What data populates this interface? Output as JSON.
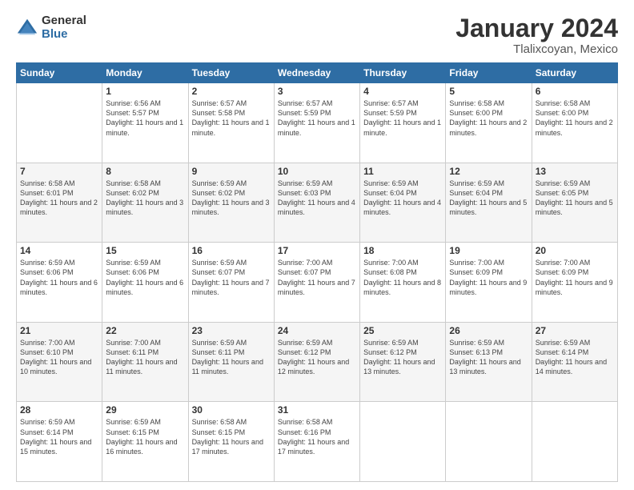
{
  "header": {
    "logo_general": "General",
    "logo_blue": "Blue",
    "title": "January 2024",
    "location": "Tlalixcoyan, Mexico"
  },
  "days_of_week": [
    "Sunday",
    "Monday",
    "Tuesday",
    "Wednesday",
    "Thursday",
    "Friday",
    "Saturday"
  ],
  "weeks": [
    [
      {
        "day": "",
        "sunrise": "",
        "sunset": "",
        "daylight": ""
      },
      {
        "day": "1",
        "sunrise": "Sunrise: 6:56 AM",
        "sunset": "Sunset: 5:57 PM",
        "daylight": "Daylight: 11 hours and 1 minute."
      },
      {
        "day": "2",
        "sunrise": "Sunrise: 6:57 AM",
        "sunset": "Sunset: 5:58 PM",
        "daylight": "Daylight: 11 hours and 1 minute."
      },
      {
        "day": "3",
        "sunrise": "Sunrise: 6:57 AM",
        "sunset": "Sunset: 5:59 PM",
        "daylight": "Daylight: 11 hours and 1 minute."
      },
      {
        "day": "4",
        "sunrise": "Sunrise: 6:57 AM",
        "sunset": "Sunset: 5:59 PM",
        "daylight": "Daylight: 11 hours and 1 minute."
      },
      {
        "day": "5",
        "sunrise": "Sunrise: 6:58 AM",
        "sunset": "Sunset: 6:00 PM",
        "daylight": "Daylight: 11 hours and 2 minutes."
      },
      {
        "day": "6",
        "sunrise": "Sunrise: 6:58 AM",
        "sunset": "Sunset: 6:00 PM",
        "daylight": "Daylight: 11 hours and 2 minutes."
      }
    ],
    [
      {
        "day": "7",
        "sunrise": "Sunrise: 6:58 AM",
        "sunset": "Sunset: 6:01 PM",
        "daylight": "Daylight: 11 hours and 2 minutes."
      },
      {
        "day": "8",
        "sunrise": "Sunrise: 6:58 AM",
        "sunset": "Sunset: 6:02 PM",
        "daylight": "Daylight: 11 hours and 3 minutes."
      },
      {
        "day": "9",
        "sunrise": "Sunrise: 6:59 AM",
        "sunset": "Sunset: 6:02 PM",
        "daylight": "Daylight: 11 hours and 3 minutes."
      },
      {
        "day": "10",
        "sunrise": "Sunrise: 6:59 AM",
        "sunset": "Sunset: 6:03 PM",
        "daylight": "Daylight: 11 hours and 4 minutes."
      },
      {
        "day": "11",
        "sunrise": "Sunrise: 6:59 AM",
        "sunset": "Sunset: 6:04 PM",
        "daylight": "Daylight: 11 hours and 4 minutes."
      },
      {
        "day": "12",
        "sunrise": "Sunrise: 6:59 AM",
        "sunset": "Sunset: 6:04 PM",
        "daylight": "Daylight: 11 hours and 5 minutes."
      },
      {
        "day": "13",
        "sunrise": "Sunrise: 6:59 AM",
        "sunset": "Sunset: 6:05 PM",
        "daylight": "Daylight: 11 hours and 5 minutes."
      }
    ],
    [
      {
        "day": "14",
        "sunrise": "Sunrise: 6:59 AM",
        "sunset": "Sunset: 6:06 PM",
        "daylight": "Daylight: 11 hours and 6 minutes."
      },
      {
        "day": "15",
        "sunrise": "Sunrise: 6:59 AM",
        "sunset": "Sunset: 6:06 PM",
        "daylight": "Daylight: 11 hours and 6 minutes."
      },
      {
        "day": "16",
        "sunrise": "Sunrise: 6:59 AM",
        "sunset": "Sunset: 6:07 PM",
        "daylight": "Daylight: 11 hours and 7 minutes."
      },
      {
        "day": "17",
        "sunrise": "Sunrise: 7:00 AM",
        "sunset": "Sunset: 6:07 PM",
        "daylight": "Daylight: 11 hours and 7 minutes."
      },
      {
        "day": "18",
        "sunrise": "Sunrise: 7:00 AM",
        "sunset": "Sunset: 6:08 PM",
        "daylight": "Daylight: 11 hours and 8 minutes."
      },
      {
        "day": "19",
        "sunrise": "Sunrise: 7:00 AM",
        "sunset": "Sunset: 6:09 PM",
        "daylight": "Daylight: 11 hours and 9 minutes."
      },
      {
        "day": "20",
        "sunrise": "Sunrise: 7:00 AM",
        "sunset": "Sunset: 6:09 PM",
        "daylight": "Daylight: 11 hours and 9 minutes."
      }
    ],
    [
      {
        "day": "21",
        "sunrise": "Sunrise: 7:00 AM",
        "sunset": "Sunset: 6:10 PM",
        "daylight": "Daylight: 11 hours and 10 minutes."
      },
      {
        "day": "22",
        "sunrise": "Sunrise: 7:00 AM",
        "sunset": "Sunset: 6:11 PM",
        "daylight": "Daylight: 11 hours and 11 minutes."
      },
      {
        "day": "23",
        "sunrise": "Sunrise: 6:59 AM",
        "sunset": "Sunset: 6:11 PM",
        "daylight": "Daylight: 11 hours and 11 minutes."
      },
      {
        "day": "24",
        "sunrise": "Sunrise: 6:59 AM",
        "sunset": "Sunset: 6:12 PM",
        "daylight": "Daylight: 11 hours and 12 minutes."
      },
      {
        "day": "25",
        "sunrise": "Sunrise: 6:59 AM",
        "sunset": "Sunset: 6:12 PM",
        "daylight": "Daylight: 11 hours and 13 minutes."
      },
      {
        "day": "26",
        "sunrise": "Sunrise: 6:59 AM",
        "sunset": "Sunset: 6:13 PM",
        "daylight": "Daylight: 11 hours and 13 minutes."
      },
      {
        "day": "27",
        "sunrise": "Sunrise: 6:59 AM",
        "sunset": "Sunset: 6:14 PM",
        "daylight": "Daylight: 11 hours and 14 minutes."
      }
    ],
    [
      {
        "day": "28",
        "sunrise": "Sunrise: 6:59 AM",
        "sunset": "Sunset: 6:14 PM",
        "daylight": "Daylight: 11 hours and 15 minutes."
      },
      {
        "day": "29",
        "sunrise": "Sunrise: 6:59 AM",
        "sunset": "Sunset: 6:15 PM",
        "daylight": "Daylight: 11 hours and 16 minutes."
      },
      {
        "day": "30",
        "sunrise": "Sunrise: 6:58 AM",
        "sunset": "Sunset: 6:15 PM",
        "daylight": "Daylight: 11 hours and 17 minutes."
      },
      {
        "day": "31",
        "sunrise": "Sunrise: 6:58 AM",
        "sunset": "Sunset: 6:16 PM",
        "daylight": "Daylight: 11 hours and 17 minutes."
      },
      {
        "day": "",
        "sunrise": "",
        "sunset": "",
        "daylight": ""
      },
      {
        "day": "",
        "sunrise": "",
        "sunset": "",
        "daylight": ""
      },
      {
        "day": "",
        "sunrise": "",
        "sunset": "",
        "daylight": ""
      }
    ]
  ]
}
